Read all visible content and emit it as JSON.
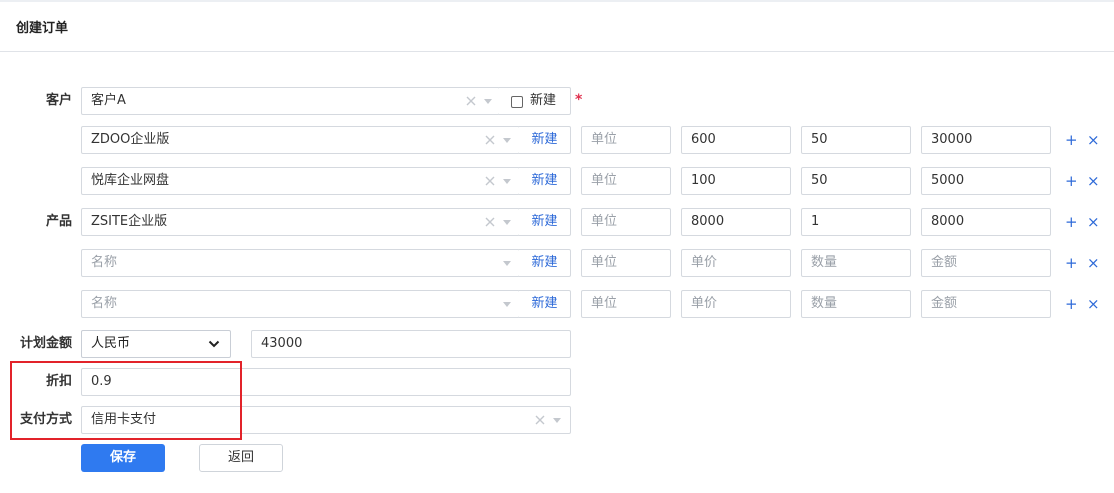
{
  "page": {
    "title": "创建订单"
  },
  "form": {
    "customer": {
      "label": "客户",
      "value": "客户A",
      "new_label": "新建",
      "required_mark": "*"
    },
    "product": {
      "label": "产品",
      "new_label": "新建",
      "rows": [
        {
          "name": "ZDOO企业版",
          "name_placeholder": "名称",
          "unit": "",
          "unit_placeholder": "单位",
          "price": "600",
          "price_placeholder": "单价",
          "quantity": "50",
          "quantity_placeholder": "数量",
          "amount": "30000",
          "amount_placeholder": "金额"
        },
        {
          "name": "悦库企业网盘",
          "name_placeholder": "名称",
          "unit": "",
          "unit_placeholder": "单位",
          "price": "100",
          "price_placeholder": "单价",
          "quantity": "50",
          "quantity_placeholder": "数量",
          "amount": "5000",
          "amount_placeholder": "金额"
        },
        {
          "name": "ZSITE企业版",
          "name_placeholder": "名称",
          "unit": "",
          "unit_placeholder": "单位",
          "price": "8000",
          "price_placeholder": "单价",
          "quantity": "1",
          "quantity_placeholder": "数量",
          "amount": "8000",
          "amount_placeholder": "金额"
        },
        {
          "name": "",
          "name_placeholder": "名称",
          "unit": "",
          "unit_placeholder": "单位",
          "price": "",
          "price_placeholder": "单价",
          "quantity": "",
          "quantity_placeholder": "数量",
          "amount": "",
          "amount_placeholder": "金额"
        },
        {
          "name": "",
          "name_placeholder": "名称",
          "unit": "",
          "unit_placeholder": "单位",
          "price": "",
          "price_placeholder": "单价",
          "quantity": "",
          "quantity_placeholder": "数量",
          "amount": "",
          "amount_placeholder": "金额"
        }
      ],
      "add_icon": "+",
      "remove_icon": "×"
    },
    "plan_amount": {
      "label": "计划金额",
      "currency": "人民币",
      "value": "43000"
    },
    "discount": {
      "label": "折扣",
      "value": "0.9"
    },
    "payment": {
      "label": "支付方式",
      "value": "信用卡支付"
    }
  },
  "actions": {
    "save_label": "保存",
    "back_label": "返回"
  },
  "colors": {
    "accent": "#2f7af0",
    "link": "#2e6ad8",
    "required": "#e0304e",
    "highlight": "#e2232a"
  }
}
